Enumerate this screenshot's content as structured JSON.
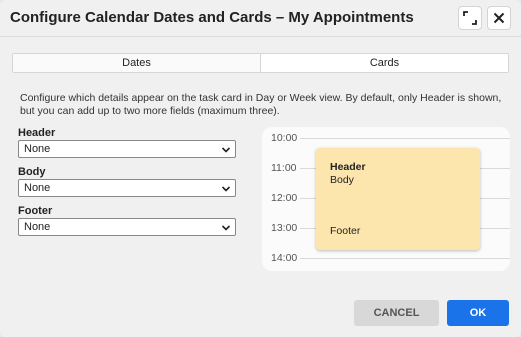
{
  "dialog": {
    "title": "Configure Calendar Dates and Cards – My Appointments",
    "maximize_icon": "maximize-icon",
    "close_icon": "close-icon"
  },
  "tabs": [
    {
      "label": "Dates",
      "selected": false
    },
    {
      "label": "Cards",
      "selected": true
    }
  ],
  "description": "Configure which details appear on the task card in Day or Week view. By default, only Header is shown, but you can add up to two more fields (maximum three).",
  "fields": [
    {
      "label": "Header",
      "value": "None"
    },
    {
      "label": "Body",
      "value": "None"
    },
    {
      "label": "Footer",
      "value": "None"
    }
  ],
  "preview": {
    "times": [
      "10:00",
      "11:00",
      "12:00",
      "13:00",
      "14:00"
    ],
    "card": {
      "header": "Header",
      "body": "Body",
      "footer": "Footer"
    }
  },
  "buttons": {
    "cancel": "CANCEL",
    "ok": "OK"
  },
  "colors": {
    "accent": "#1a73e8",
    "card": "#fde6ad"
  }
}
